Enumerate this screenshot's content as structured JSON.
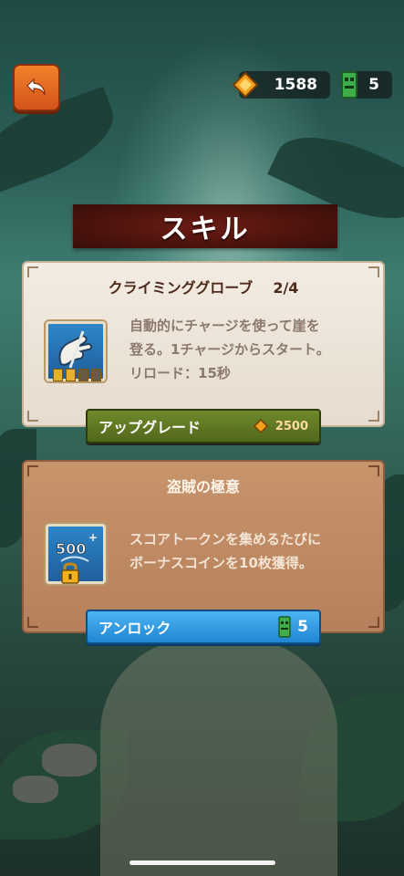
{
  "header": {
    "gems": "1588",
    "totems": "5"
  },
  "title": "スキル",
  "skills": [
    {
      "name": "クライミンググローブ",
      "level": "2/4",
      "description_line1": "自動的にチャージを使って崖を",
      "description_line2": "登る。1チャージからスタート。",
      "description_line3": "リロード：15秒",
      "charges_filled": 2,
      "charges_total": 4,
      "action_label": "アップグレード",
      "price": "2500"
    },
    {
      "name": "盗賊の極意",
      "description_line1": "スコアトークンを集めるたびに",
      "description_line2": "ボーナスコインを10枚獲得。",
      "icon_text": "500",
      "action_label": "アンロック",
      "price": "5"
    }
  ],
  "icons": {
    "back": "back-arrow-icon",
    "gem": "gem-icon",
    "totem": "totem-icon",
    "lock": "padlock-icon"
  },
  "colors": {
    "upgrade": "#5f7a24",
    "unlock": "#2a96e0",
    "title_ribbon": "#4c130d",
    "back_button": "#e2662a"
  }
}
